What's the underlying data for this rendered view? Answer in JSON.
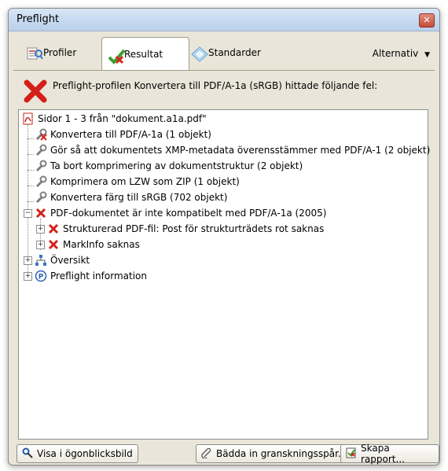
{
  "window": {
    "title": "Preflight"
  },
  "tabs": [
    {
      "label": "Profiler",
      "icon": "profiles-icon"
    },
    {
      "label": "Resultat",
      "icon": "results-icon"
    },
    {
      "label": "Standarder",
      "icon": "standards-icon"
    }
  ],
  "options_menu": {
    "label": "Alternativ"
  },
  "message": {
    "text": "Preflight-profilen Konvertera till PDF/A-1a (sRGB) hittade följande fel:"
  },
  "tree": {
    "root": "Sidor 1 - 3 från \"dokument.a1a.pdf\"",
    "fixups": [
      "Konvertera till PDF/A-1a (1 objekt)",
      "Gör så att dokumentets XMP-metadata överensstämmer med PDF/A-1 (2 objekt)",
      "Ta bort komprimering av dokumentstruktur (2 objekt)",
      "Komprimera om LZW som ZIP (1 objekt)",
      "Konvertera färg till sRGB (702 objekt)"
    ],
    "error_group": "PDF-dokumentet är inte kompatibelt med PDF/A-1a (2005)",
    "errors": [
      "Strukturerad PDF-fil: Post för strukturträdets rot saknas",
      "MarkInfo saknas"
    ],
    "overview": "Översikt",
    "preflight_info": "Preflight information"
  },
  "buttons": {
    "snapshot": "Visa i ögonblicksbild",
    "embed": "Bädda in granskningsspår...",
    "report": "Skapa rapport..."
  }
}
